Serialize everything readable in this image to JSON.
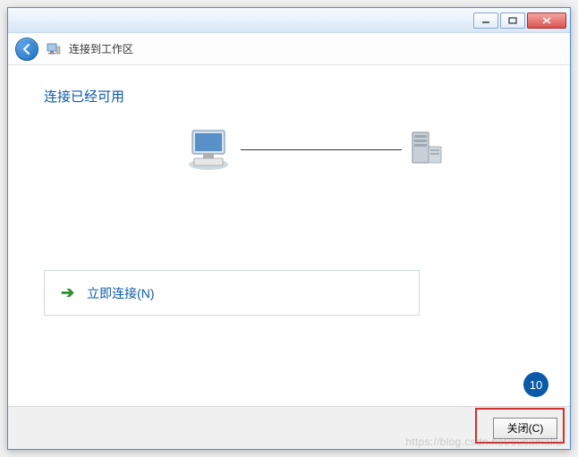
{
  "titlebar": {
    "minimize_tooltip": "最小化",
    "maximize_tooltip": "最大化",
    "close_tooltip": "关闭"
  },
  "header": {
    "title": "连接到工作区",
    "back_tooltip": "返回"
  },
  "content": {
    "heading": "连接已经可用",
    "option_label": "立即连接(N)"
  },
  "footer": {
    "close_button": "关闭(C)"
  },
  "annotation": {
    "step_number": "10"
  },
  "watermark": "https://blog.csdn.net/ousamaliu"
}
